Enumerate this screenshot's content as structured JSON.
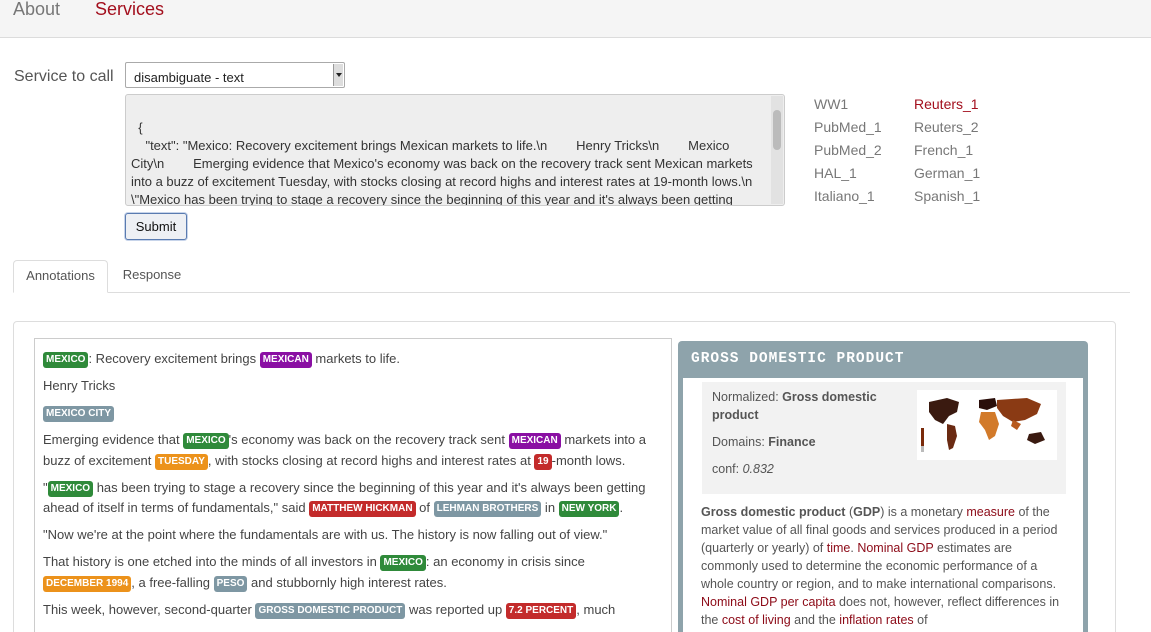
{
  "nav": {
    "about": "About",
    "services": "Services"
  },
  "form": {
    "service_label": "Service to call",
    "selected_service": "disambiguate - text",
    "text_value": "{\n    \"text\": \"Mexico: Recovery excitement brings Mexican markets to life.\\n        Henry Tricks\\n        Mexico City\\n        Emerging evidence that Mexico's economy was back on the recovery track sent Mexican markets into a buzz of excitement Tuesday, with stocks closing at record highs and interest rates at 19-month lows.\\n \\\"Mexico has been trying to stage a recovery since the beginning of this year and it's always been getting ahead of itself in terms of fundamentals,\\\" said Matthew Hickman of Lehman Brothers in New York.\\n",
    "submit_label": "Submit"
  },
  "examples": [
    {
      "label": "WW1",
      "active": false
    },
    {
      "label": "PubMed_1",
      "active": false
    },
    {
      "label": "PubMed_2",
      "active": false
    },
    {
      "label": "HAL_1",
      "active": false
    },
    {
      "label": "Italiano_1",
      "active": false
    },
    {
      "label": "Reuters_1",
      "active": true
    },
    {
      "label": "Reuters_2",
      "active": false
    },
    {
      "label": "French_1",
      "active": false
    },
    {
      "label": "German_1",
      "active": false
    },
    {
      "label": "Spanish_1",
      "active": false
    }
  ],
  "tabs": [
    {
      "label": "Annotations",
      "active": true
    },
    {
      "label": "Response",
      "active": false
    }
  ],
  "annotations": {
    "p1": {
      "t1": "MEXICO",
      "s1": ": Recovery excitement brings ",
      "t2": "MEXICAN",
      "s2": " markets to life."
    },
    "p2": {
      "s1": "Henry Tricks"
    },
    "p3": {
      "t1": "MEXICO CITY"
    },
    "p4": {
      "s1": "Emerging evidence that ",
      "t1": "MEXICO",
      "s2": "'s economy was back on the recovery track sent ",
      "t2": "MEXICAN",
      "s3": " markets into a buzz of excitement ",
      "t3": "TUESDAY",
      "s4": ", with stocks closing at record highs and interest rates at ",
      "t4": "19",
      "s5": "-month lows."
    },
    "p5": {
      "s1": "\"",
      "t1": "MEXICO",
      "s2": " has been trying to stage a recovery since the beginning of this year and it's always been getting ahead of itself in terms of fundamentals,\" said ",
      "t2": "MATTHEW HICKMAN",
      "s3": " of ",
      "t3": "LEHMAN BROTHERS",
      "s4": " in ",
      "t4": "NEW YORK",
      "s5": "."
    },
    "p6": {
      "s1": "\"Now we're at the point where the fundamentals are with us. The history is now falling out of view.\""
    },
    "p7": {
      "s1": "That history is one etched into the minds of all investors in ",
      "t1": "MEXICO",
      "s2": ": an economy in crisis since ",
      "t2": "DECEMBER 1994",
      "s3": ", a free-falling ",
      "t3": "PESO",
      "s4": " and stubbornly high interest rates."
    },
    "p8": {
      "s1": "This week, however, second-quarter ",
      "t1": "GROSS DOMESTIC PRODUCT",
      "s2": " was reported up ",
      "t2": "7.2 PERCENT",
      "s3": ", much"
    }
  },
  "entity_card": {
    "title": "GROSS DOMESTIC PRODUCT",
    "normalized_label": "Normalized:",
    "normalized_value": "Gross domestic product",
    "domains_label": "Domains:",
    "domains_value": "Finance",
    "conf_label": "conf:",
    "conf_value": "0.832",
    "desc": {
      "d1": "Gross domestic product",
      "d2": " (",
      "d3": "GDP",
      "d4": ") is a monetary ",
      "d5": "measure",
      "d6": " of the market value of all final goods and services produced in a period (quarterly or yearly) of ",
      "d7": "time",
      "d8": ". ",
      "d9": "Nominal GDP",
      "d10": " estimates are commonly used to determine the economic performance of a whole country or region, and to make international comparisons. ",
      "d11": "Nominal GDP per capita",
      "d12": " does not, however, reflect differences in the ",
      "d13": "cost of living",
      "d14": " and the ",
      "d15": "inflation rates",
      "d16": " of"
    }
  }
}
